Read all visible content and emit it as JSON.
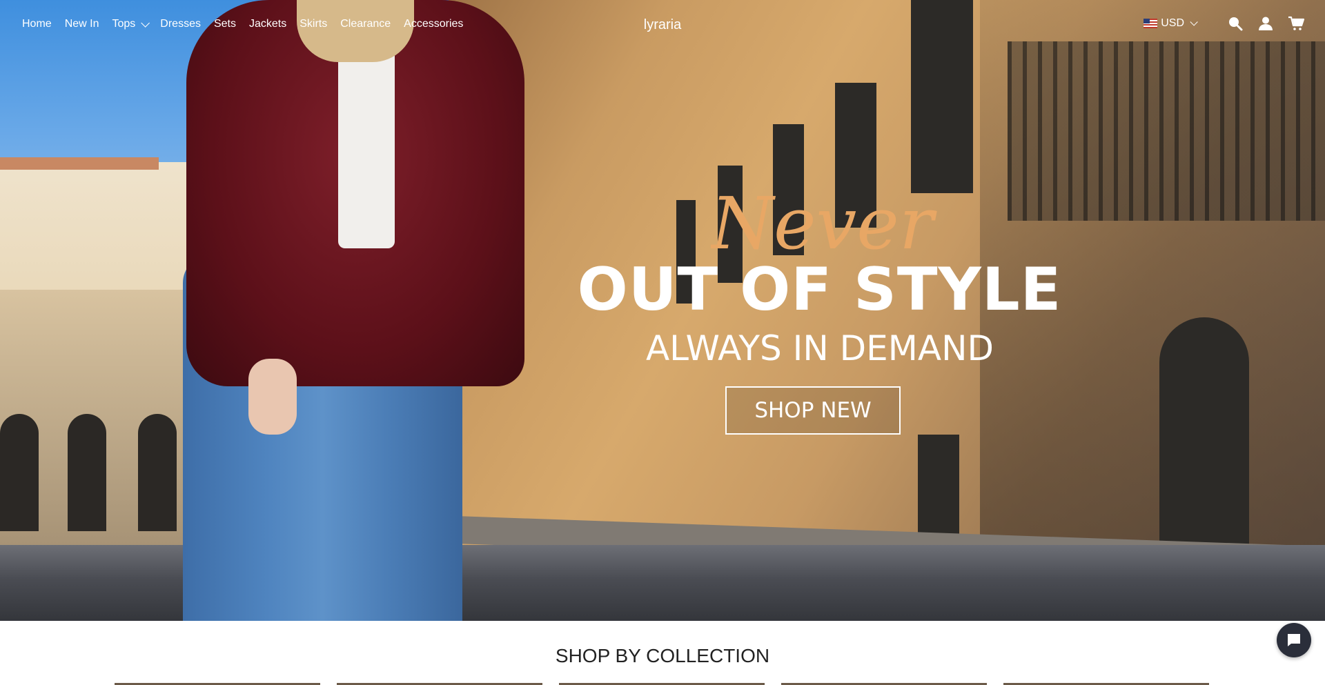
{
  "header": {
    "nav": [
      {
        "label": "Home"
      },
      {
        "label": "New In"
      },
      {
        "label": "Tops",
        "has_dropdown": true
      },
      {
        "label": "Dresses"
      },
      {
        "label": "Sets"
      },
      {
        "label": "Jackets"
      },
      {
        "label": "Skirts"
      },
      {
        "label": "Clearance"
      },
      {
        "label": "Accessories"
      }
    ],
    "logo": "lyraria",
    "currency": "USD",
    "icons": [
      "search-icon",
      "account-icon",
      "cart-icon"
    ]
  },
  "hero": {
    "script_word": "Never",
    "headline": "OUT OF STYLE",
    "subline": "ALWAYS IN DEMAND",
    "cta": "SHOP NEW",
    "accent_color": "#e8a765"
  },
  "collection": {
    "title": "SHOP BY COLLECTION"
  },
  "chat": {
    "icon": "chat-icon"
  }
}
